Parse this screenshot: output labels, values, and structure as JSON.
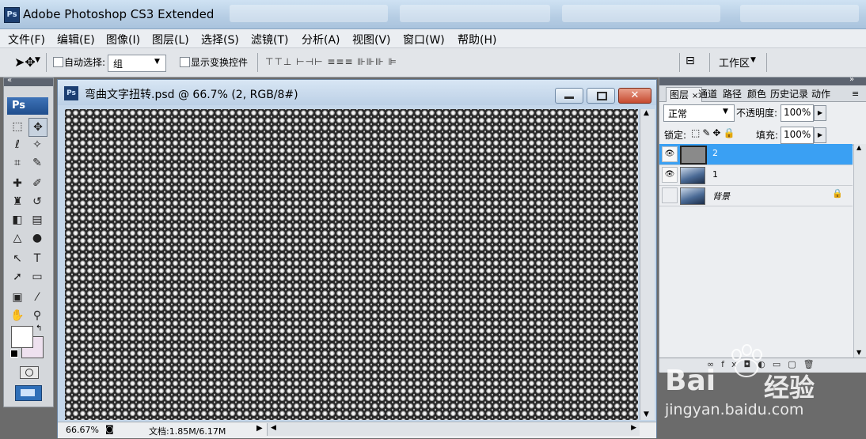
{
  "window": {
    "title": "Adobe Photoshop CS3 Extended",
    "logo": "Ps"
  },
  "menu": [
    "文件(F)",
    "编辑(E)",
    "图像(I)",
    "图层(L)",
    "选择(S)",
    "滤镜(T)",
    "分析(A)",
    "视图(V)",
    "窗口(W)",
    "帮助(H)"
  ],
  "options": {
    "auto_select_label": "自动选择:",
    "auto_select_value": "组",
    "show_transform_label": "显示变换控件",
    "workspace_label": "工作区"
  },
  "document": {
    "title": "弯曲文字扭转.psd @ 66.7% (2, RGB/8#)",
    "doc_icon": "Ps",
    "zoom": "66.67%",
    "doc_size": "文档:1.85M/6.17M"
  },
  "toolbox": {
    "logo": "Ps"
  },
  "layers_panel": {
    "tabs": [
      "图层",
      "通道",
      "路径",
      "颜色",
      "历史记录",
      "动作"
    ],
    "blend_mode": "正常",
    "opacity_label": "不透明度:",
    "opacity_value": "100%",
    "lock_label": "锁定:",
    "fill_label": "填充:",
    "fill_value": "100%",
    "layers": [
      {
        "name": "2",
        "selected": true,
        "visible": true
      },
      {
        "name": "1",
        "selected": false,
        "visible": true
      },
      {
        "name": "背景",
        "selected": false,
        "visible": false,
        "locked": true
      }
    ]
  },
  "watermark": {
    "brand": "Bai",
    "brand2": "经验",
    "url": "jingyan.baidu.com"
  },
  "colors": {
    "accent": "#3399ff",
    "selected_layer": "#3aa0f3"
  }
}
